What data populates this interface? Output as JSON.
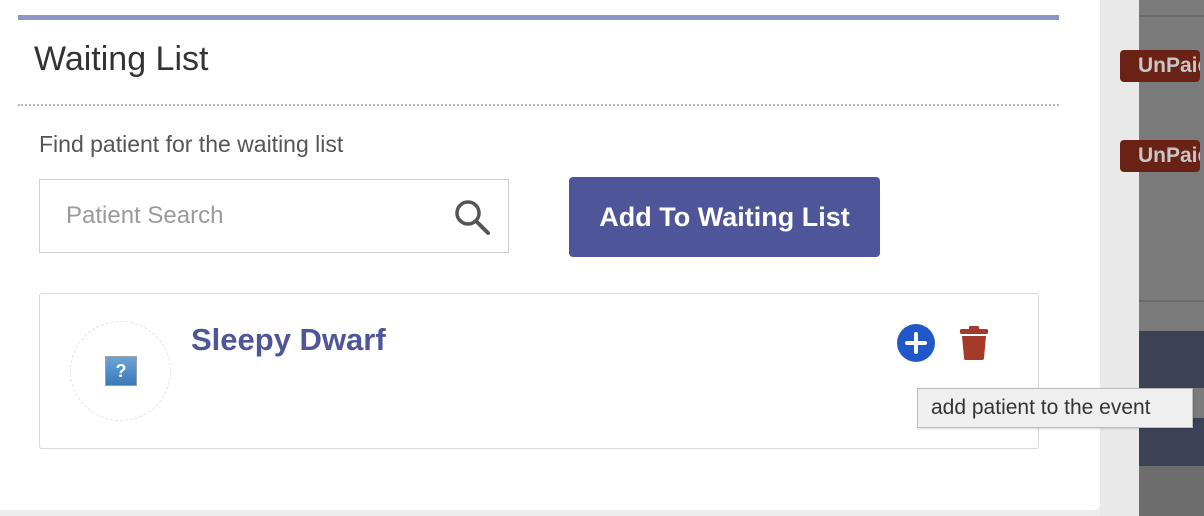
{
  "background": {
    "badges": [
      {
        "label": "UnPaid"
      },
      {
        "label": "UnPaid"
      }
    ]
  },
  "modal": {
    "title": "Waiting List",
    "find_label": "Find patient for the waiting list",
    "search": {
      "placeholder": "Patient Search",
      "value": ""
    },
    "add_button_label": "Add To Waiting List",
    "patients": [
      {
        "name": "Sleepy Dwarf",
        "avatar_icon": "broken-image-icon",
        "actions": [
          {
            "icon": "plus-circle-icon"
          },
          {
            "icon": "trash-icon"
          }
        ]
      }
    ],
    "tooltip": "add patient to the event"
  },
  "colors": {
    "accent": "#4e5599",
    "topbar": "#8c96c7",
    "add_icon": "#2058c9",
    "trash_icon": "#a33a2a",
    "badge": "#6b2216"
  }
}
